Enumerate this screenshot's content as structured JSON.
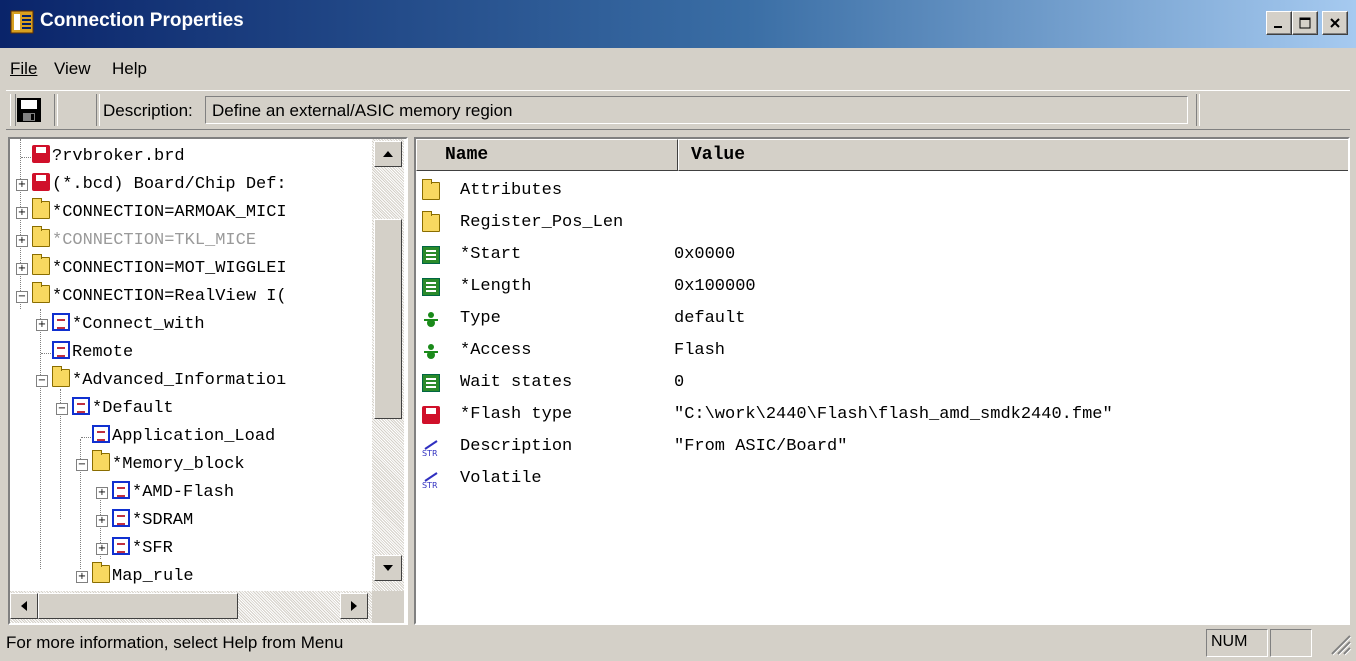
{
  "window": {
    "title": "Connection Properties",
    "min": "_",
    "max": "□",
    "close": "×"
  },
  "menu": [
    {
      "label": "File",
      "key": "F"
    },
    {
      "label": "View",
      "key": "V"
    },
    {
      "label": "Help",
      "key": "H"
    }
  ],
  "toolbar": {
    "desc_label": "Description:",
    "desc_value": "Define an external/ASIC memory region"
  },
  "tree": [
    {
      "label": "?rvbroker.brd",
      "icon": "disk-icon"
    },
    {
      "label": "(*.bcd) Board/Chip Def:",
      "icon": "disk-icon"
    },
    {
      "label": "*CONNECTION=ARMOAK_MICI",
      "icon": "folder-icon"
    },
    {
      "label": "*CONNECTION=TKL_MICE",
      "icon": "folder-icon"
    },
    {
      "label": "*CONNECTION=MOT_WIGGLEI",
      "icon": "folder-icon"
    },
    {
      "label": "*CONNECTION=RealView I(",
      "icon": "folder-icon"
    },
    {
      "label": "*Connect_with",
      "icon": "document-icon"
    },
    {
      "label": "Remote",
      "icon": "document-icon"
    },
    {
      "label": "*Advanced_Informatioı",
      "icon": "folder-icon"
    },
    {
      "label": "*Default",
      "icon": "document-icon"
    },
    {
      "label": "Application_Load",
      "icon": "document-icon"
    },
    {
      "label": "*Memory_block",
      "icon": "folder-icon"
    },
    {
      "label": "*AMD-Flash",
      "icon": "document-edit-icon"
    },
    {
      "label": "*SDRAM",
      "icon": "document-icon"
    },
    {
      "label": "*SFR",
      "icon": "document-icon"
    },
    {
      "label": "Map_rule",
      "icon": "folder-icon"
    }
  ],
  "list": {
    "col_name": "Name",
    "col_value": "Value",
    "rows": [
      {
        "name": "Attributes",
        "value": "",
        "icon": "folder-icon"
      },
      {
        "name": "Register_Pos_Len",
        "value": "",
        "icon": "folder-icon"
      },
      {
        "name": "*Start",
        "value": "0x0000",
        "icon": "numeric-icon"
      },
      {
        "name": "*Length",
        "value": "0x100000",
        "icon": "numeric-icon"
      },
      {
        "name": "Type",
        "value": "default",
        "icon": "enum-icon"
      },
      {
        "name": "*Access",
        "value": "Flash",
        "icon": "enum-icon"
      },
      {
        "name": "Wait states",
        "value": "0",
        "icon": "numeric-icon"
      },
      {
        "name": "*Flash type",
        "value": "\"C:\\work\\2440\\Flash\\flash_amd_smdk2440.fme\"",
        "icon": "disk-icon"
      },
      {
        "name": "Description",
        "value": "\"From ASIC/Board\"",
        "icon": "string-icon"
      },
      {
        "name": "Volatile",
        "value": "",
        "icon": "string-icon"
      }
    ]
  },
  "status": {
    "text": "For more information, select Help from Menu",
    "num": "NUM"
  }
}
